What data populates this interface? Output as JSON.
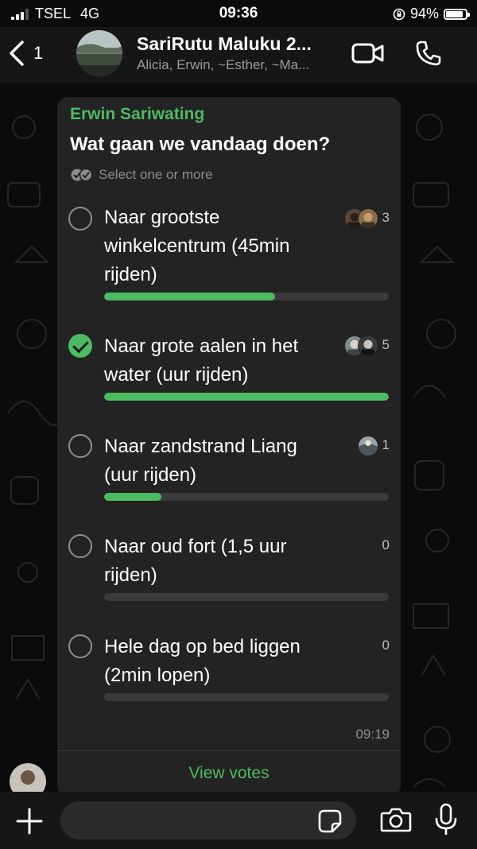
{
  "status_bar": {
    "carrier": "TSEL",
    "network": "4G",
    "time": "09:36",
    "battery": "94%",
    "battery_level": 0.94
  },
  "header": {
    "back_count": "1",
    "title": "SariRutu Maluku 2...",
    "subtitle": "Alicia, Erwin, ~Esther, ~Ma..."
  },
  "poll": {
    "sender": "Erwin Sariwating",
    "question": "Wat gaan we vandaag doen?",
    "hint": "Select one or more",
    "options": [
      {
        "text": "Naar grootste winkelcentrum (45min rijden)",
        "votes": "3",
        "fraction": 0.6,
        "selected": false
      },
      {
        "text": "Naar grote aalen in het water (uur rijden)",
        "votes": "5",
        "fraction": 1.0,
        "selected": true
      },
      {
        "text": "Naar zandstrand Liang (uur rijden)",
        "votes": "1",
        "fraction": 0.2,
        "selected": false
      },
      {
        "text": "Naar oud fort (1,5 uur rijden)",
        "votes": "0",
        "fraction": 0,
        "selected": false
      },
      {
        "text": "Hele dag op bed liggen (2min lopen)",
        "votes": "0",
        "fraction": 0,
        "selected": false
      }
    ],
    "time": "09:19",
    "view_votes": "View votes"
  },
  "composer": {
    "placeholder": ""
  },
  "colors": {
    "accent": "#4dbb61",
    "bubble": "#232323",
    "background": "#0b0b0b",
    "track": "#3a3a3a"
  }
}
